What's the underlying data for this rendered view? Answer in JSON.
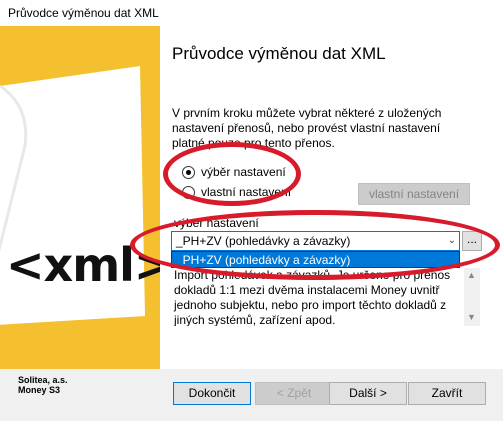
{
  "window": {
    "title": "Průvodce výměnou dat XML"
  },
  "sidebar": {
    "logo_text": "<xml>"
  },
  "wizard": {
    "heading": "Průvodce výměnou dat XML",
    "description": "V prvním kroku můžete vybrat některé z uložených nastavení přenosů, nebo provést vlastní nastavení platné pouze pro tento přenos.",
    "radio_select": "výběr nastavení",
    "radio_own": "vlastní nastavení",
    "own_button": "vlastní nastavení",
    "select_label": "výběr nastavení",
    "combo_value": "_PH+ZV (pohledávky a závazky)",
    "dots_button": "...",
    "dropdown_option": "_PH+ZV (pohledávky a závazky)",
    "memo_text": "Import pohledávek a závazků. Je určeno pro přenos dokladů 1:1 mezi dvěma instalacemi Money uvnitř jednoho subjektu, nebo pro import těchto dokladů z jiných systémů, zařízení apod."
  },
  "footer": {
    "brand_line1": "Solitea, a.s.",
    "brand_line2": "Money S3",
    "finish": "Dokončit",
    "back": "< Zpět",
    "next": "Další >",
    "close": "Zavřít"
  },
  "annotation_color": "#d81b2a"
}
